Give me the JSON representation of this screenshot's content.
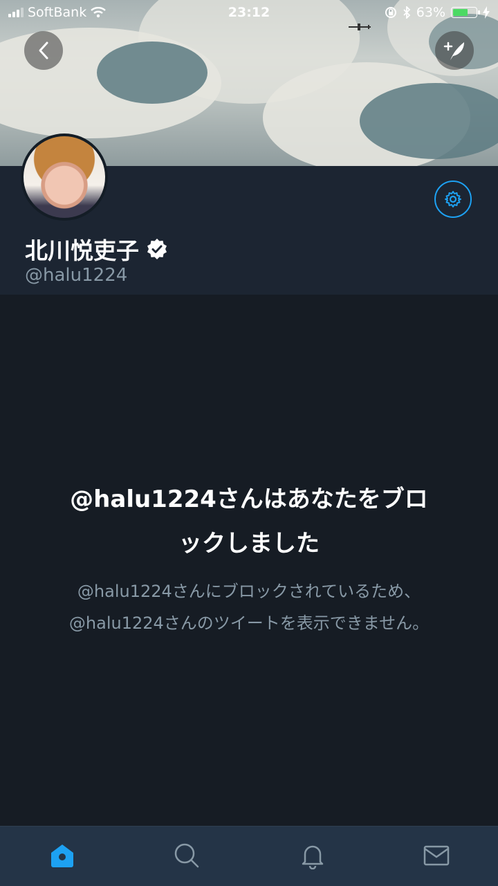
{
  "status_bar": {
    "carrier": "SoftBank",
    "time": "23:12",
    "battery_percent": "63%",
    "battery_level": 0.63,
    "icons": [
      "signal-icon",
      "wifi-icon",
      "orientation-lock-icon",
      "bluetooth-icon",
      "battery-icon",
      "charging-icon"
    ]
  },
  "header": {
    "back_icon": "back-arrow-icon",
    "compose_icon": "compose-tweet-icon"
  },
  "profile": {
    "name": "北川悦吏子",
    "handle": "@halu1224",
    "verified": true,
    "settings_icon": "gear-icon",
    "accent_color": "#1da1f2"
  },
  "blocked": {
    "title_line1": "@halu1224さんはあなたをブロ",
    "title_line2": "ックしました",
    "desc_line1": "@halu1224さんにブロックされているため、",
    "desc_line2": "@halu1224さんのツイートを表示できません。"
  },
  "tabbar": {
    "items": [
      {
        "icon": "home-icon",
        "active": true
      },
      {
        "icon": "search-icon",
        "active": false
      },
      {
        "icon": "bell-icon",
        "active": false
      },
      {
        "icon": "mail-icon",
        "active": false
      }
    ]
  }
}
